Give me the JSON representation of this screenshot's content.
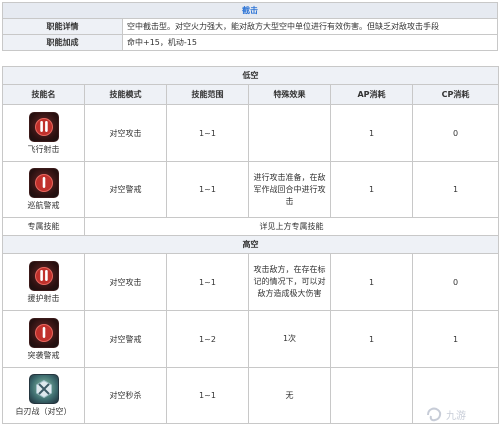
{
  "top": {
    "title": "截击",
    "rows": [
      {
        "label": "职能详情",
        "value": "空中截击型。对空火力强大，能对敌方大型空中单位进行有效伤害。但缺乏对敌攻击手段"
      },
      {
        "label": "职能加成",
        "value": "命中+15，机动-15"
      }
    ]
  },
  "main": {
    "section_low": "低空",
    "section_high": "高空",
    "columns": [
      "技能名",
      "技能模式",
      "技能范围",
      "特殊效果",
      "AP消耗",
      "CP消耗"
    ],
    "low_skills": [
      {
        "name": "飞行射击",
        "icon": "twin-missile-icon",
        "mode": "对空攻击",
        "range": "1~1",
        "effect": "",
        "ap": "1",
        "cp": "0"
      },
      {
        "name": "巡航警戒",
        "icon": "single-missile-icon",
        "mode": "对空警戒",
        "range": "1~1",
        "effect": "进行攻击准备，在敌军作战回合中进行攻击",
        "ap": "1",
        "cp": "1"
      }
    ],
    "exclusive": {
      "label": "专属技能",
      "value": "详见上方专属技能"
    },
    "high_skills": [
      {
        "name": "援护射击",
        "icon": "twin-missile-icon",
        "mode": "对空攻击",
        "range": "1~1",
        "effect": "攻击敌方，在存在标记的情况下，可以对敌方造成极大伤害",
        "ap": "1",
        "cp": "0"
      },
      {
        "name": "突袭警戒",
        "icon": "single-missile-icon",
        "mode": "对空警戒",
        "range": "1~2",
        "effect": "1次",
        "ap": "1",
        "cp": "1"
      },
      {
        "name": "白刃战（对空）",
        "icon": "crossed-blades-icon",
        "mode": "对空秒杀",
        "range": "1~1",
        "effect": "无",
        "ap": "",
        "cp": ""
      }
    ]
  },
  "watermark": "九游"
}
